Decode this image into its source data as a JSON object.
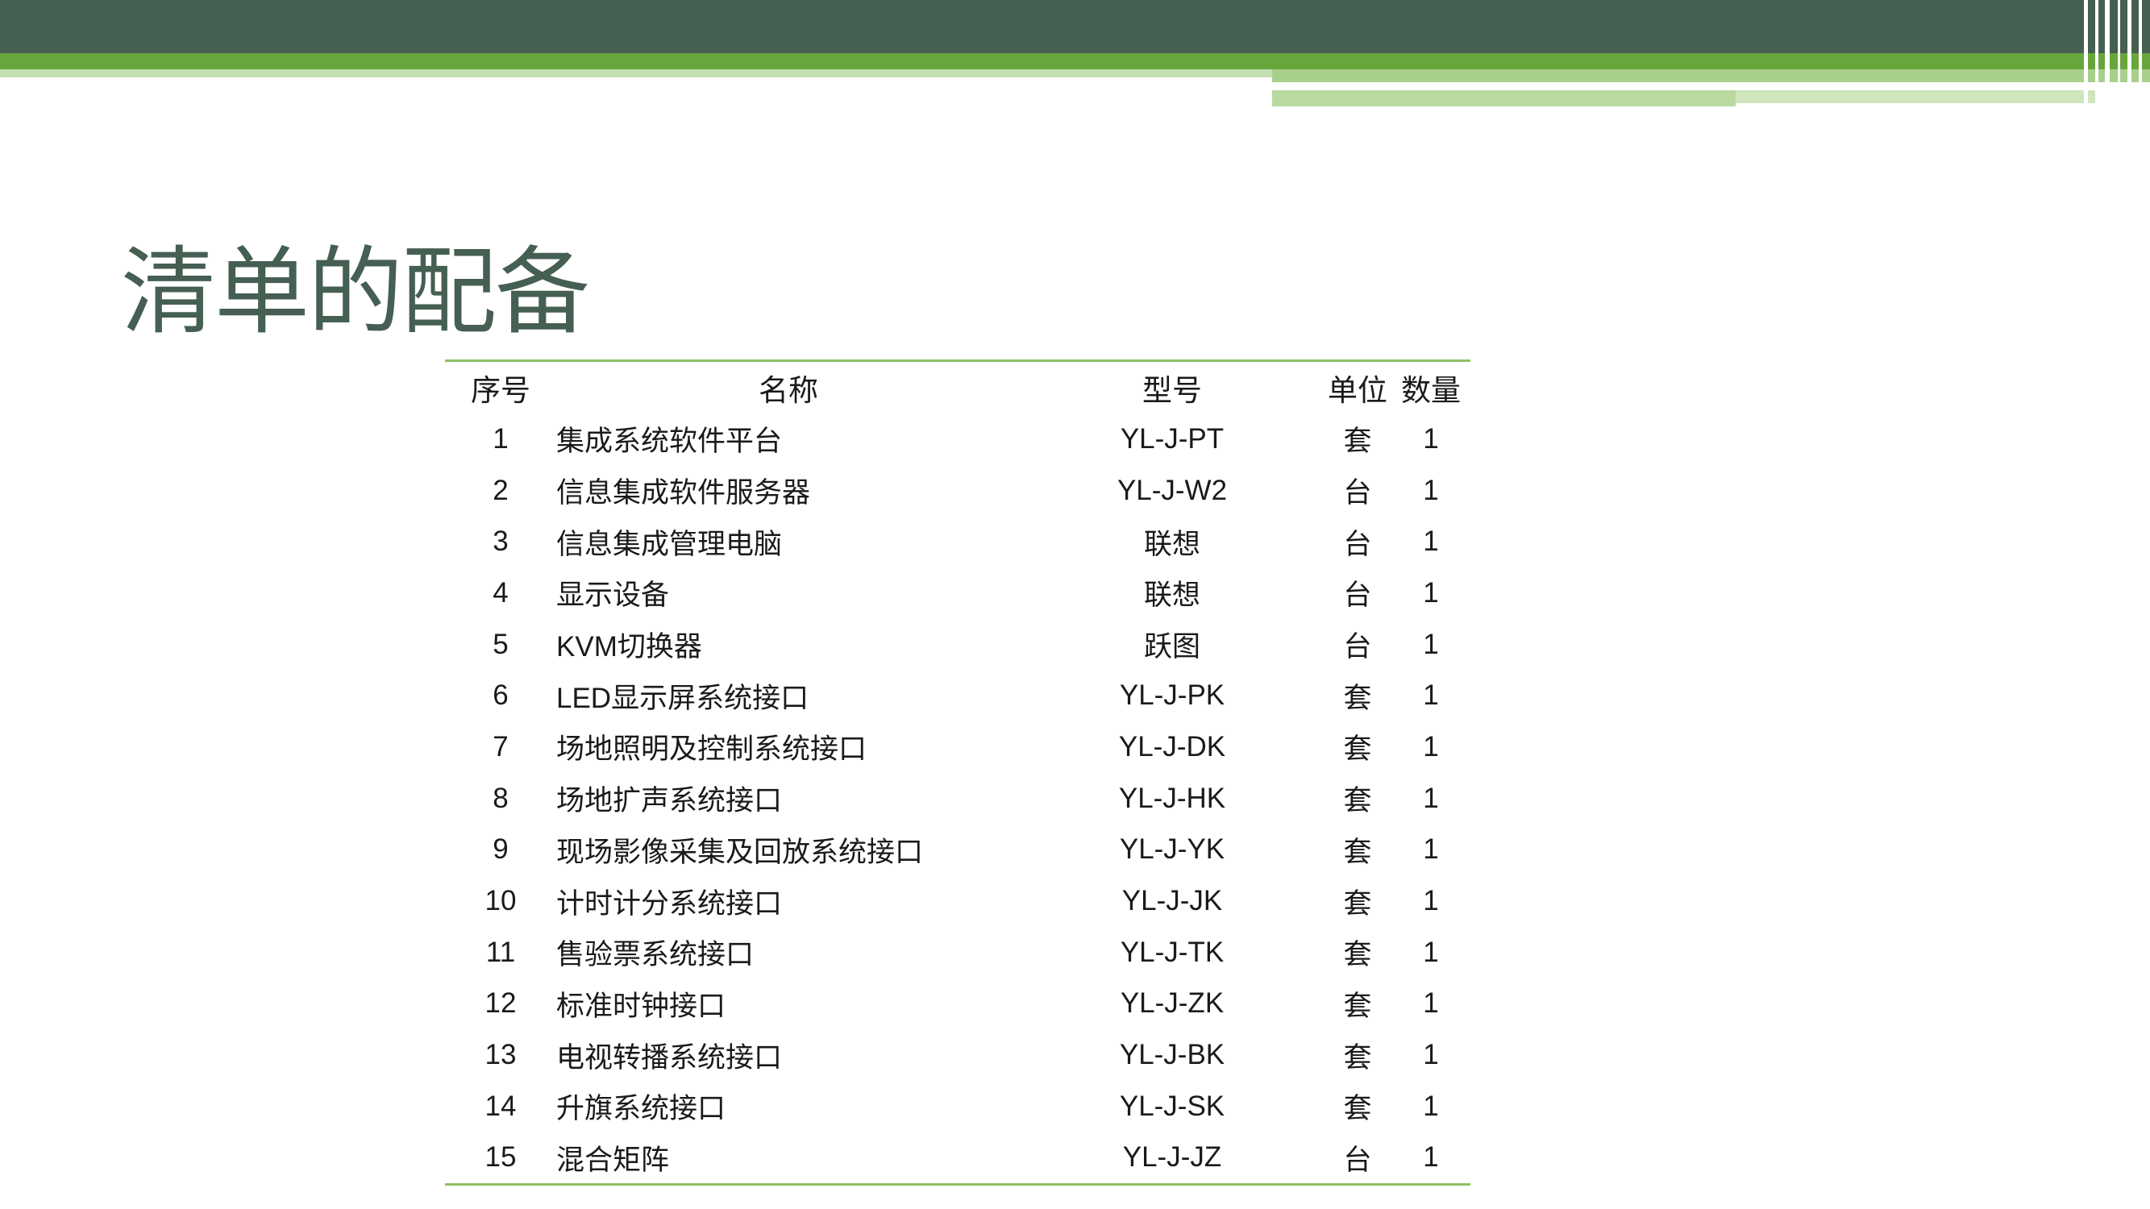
{
  "colors": {
    "title": "#455f52",
    "bar_dark": "#455f52",
    "bar_green": "#66a63a",
    "table_rule": "#8dc063"
  },
  "title": "清单的配备",
  "table": {
    "headers": {
      "no": "序号",
      "name": "名称",
      "model": "型号",
      "unit": "单位",
      "qty": "数量"
    },
    "rows": [
      {
        "no": "1",
        "name": "集成系统软件平台",
        "model": "YL-J-PT",
        "unit": "套",
        "qty": "1"
      },
      {
        "no": "2",
        "name": "信息集成软件服务器",
        "model": "YL-J-W2",
        "unit": "台",
        "qty": "1"
      },
      {
        "no": "3",
        "name": "信息集成管理电脑",
        "model": "联想",
        "unit": "台",
        "qty": "1"
      },
      {
        "no": "4",
        "name": "显示设备",
        "model": "联想",
        "unit": "台",
        "qty": "1"
      },
      {
        "no": "5",
        "name": "KVM切换器",
        "model": "跃图",
        "unit": "台",
        "qty": "1"
      },
      {
        "no": "6",
        "name": "LED显示屏系统接口",
        "model": "YL-J-PK",
        "unit": "套",
        "qty": "1"
      },
      {
        "no": "7",
        "name": "场地照明及控制系统接口",
        "model": "YL-J-DK",
        "unit": "套",
        "qty": "1"
      },
      {
        "no": "8",
        "name": "场地扩声系统接口",
        "model": "YL-J-HK",
        "unit": "套",
        "qty": "1"
      },
      {
        "no": "9",
        "name": "现场影像采集及回放系统接口",
        "model": "YL-J-YK",
        "unit": "套",
        "qty": "1"
      },
      {
        "no": "10",
        "name": "计时计分系统接口",
        "model": "YL-J-JK",
        "unit": "套",
        "qty": "1"
      },
      {
        "no": "11",
        "name": "售验票系统接口",
        "model": "YL-J-TK",
        "unit": "套",
        "qty": "1"
      },
      {
        "no": "12",
        "name": "标准时钟接口",
        "model": "YL-J-ZK",
        "unit": "套",
        "qty": "1"
      },
      {
        "no": "13",
        "name": "电视转播系统接口",
        "model": "YL-J-BK",
        "unit": "套",
        "qty": "1"
      },
      {
        "no": "14",
        "name": "升旗系统接口",
        "model": "YL-J-SK",
        "unit": "套",
        "qty": "1"
      },
      {
        "no": "15",
        "name": "混合矩阵",
        "model": "YL-J-JZ",
        "unit": "台",
        "qty": "1"
      }
    ]
  }
}
